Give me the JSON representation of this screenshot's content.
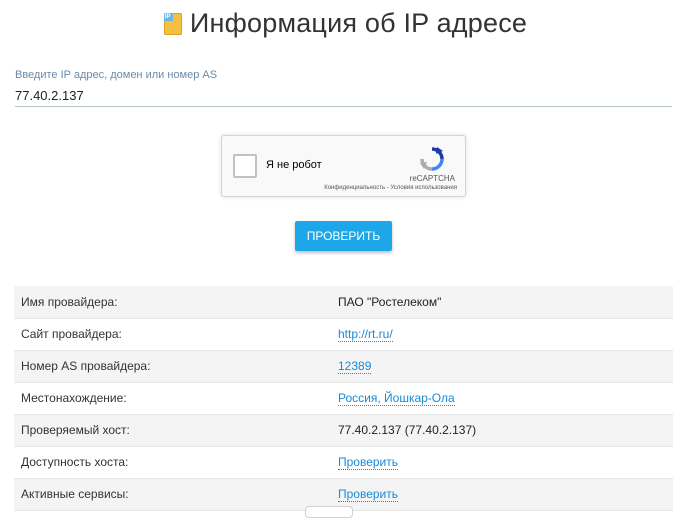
{
  "header": {
    "title": "Информация об IP адресе",
    "icon": "ip-document-icon",
    "icon_text": "IP"
  },
  "form": {
    "label": "Введите IP адрес, домен или номер AS",
    "value": "77.40.2.137",
    "captcha": {
      "label": "Я не робот",
      "brand": "reCAPTCHA",
      "links": "Конфиденциальность - Условия использования"
    },
    "submit_label": "ПРОВЕРИТЬ"
  },
  "info": [
    {
      "key": "Имя провайдера:",
      "value": "ПАО \"Ростелеком\"",
      "link": false
    },
    {
      "key": "Сайт провайдера:",
      "value": "http://rt.ru/",
      "link": true
    },
    {
      "key": "Номер AS провайдера:",
      "value": "12389",
      "link": true
    },
    {
      "key": "Местонахождение:",
      "value": "Россия, Йошкар-Ола",
      "link": true
    },
    {
      "key": "Проверяемый хост:",
      "value": "77.40.2.137 (77.40.2.137)",
      "link": false
    },
    {
      "key": "Доступность хоста:",
      "value": "Проверить",
      "link": true
    },
    {
      "key": "Активные сервисы:",
      "value": "Проверить",
      "link": true
    }
  ],
  "colors": {
    "accent": "#1ea7e8",
    "link": "#1a8ad4",
    "row_alt": "#f4f4f4"
  }
}
